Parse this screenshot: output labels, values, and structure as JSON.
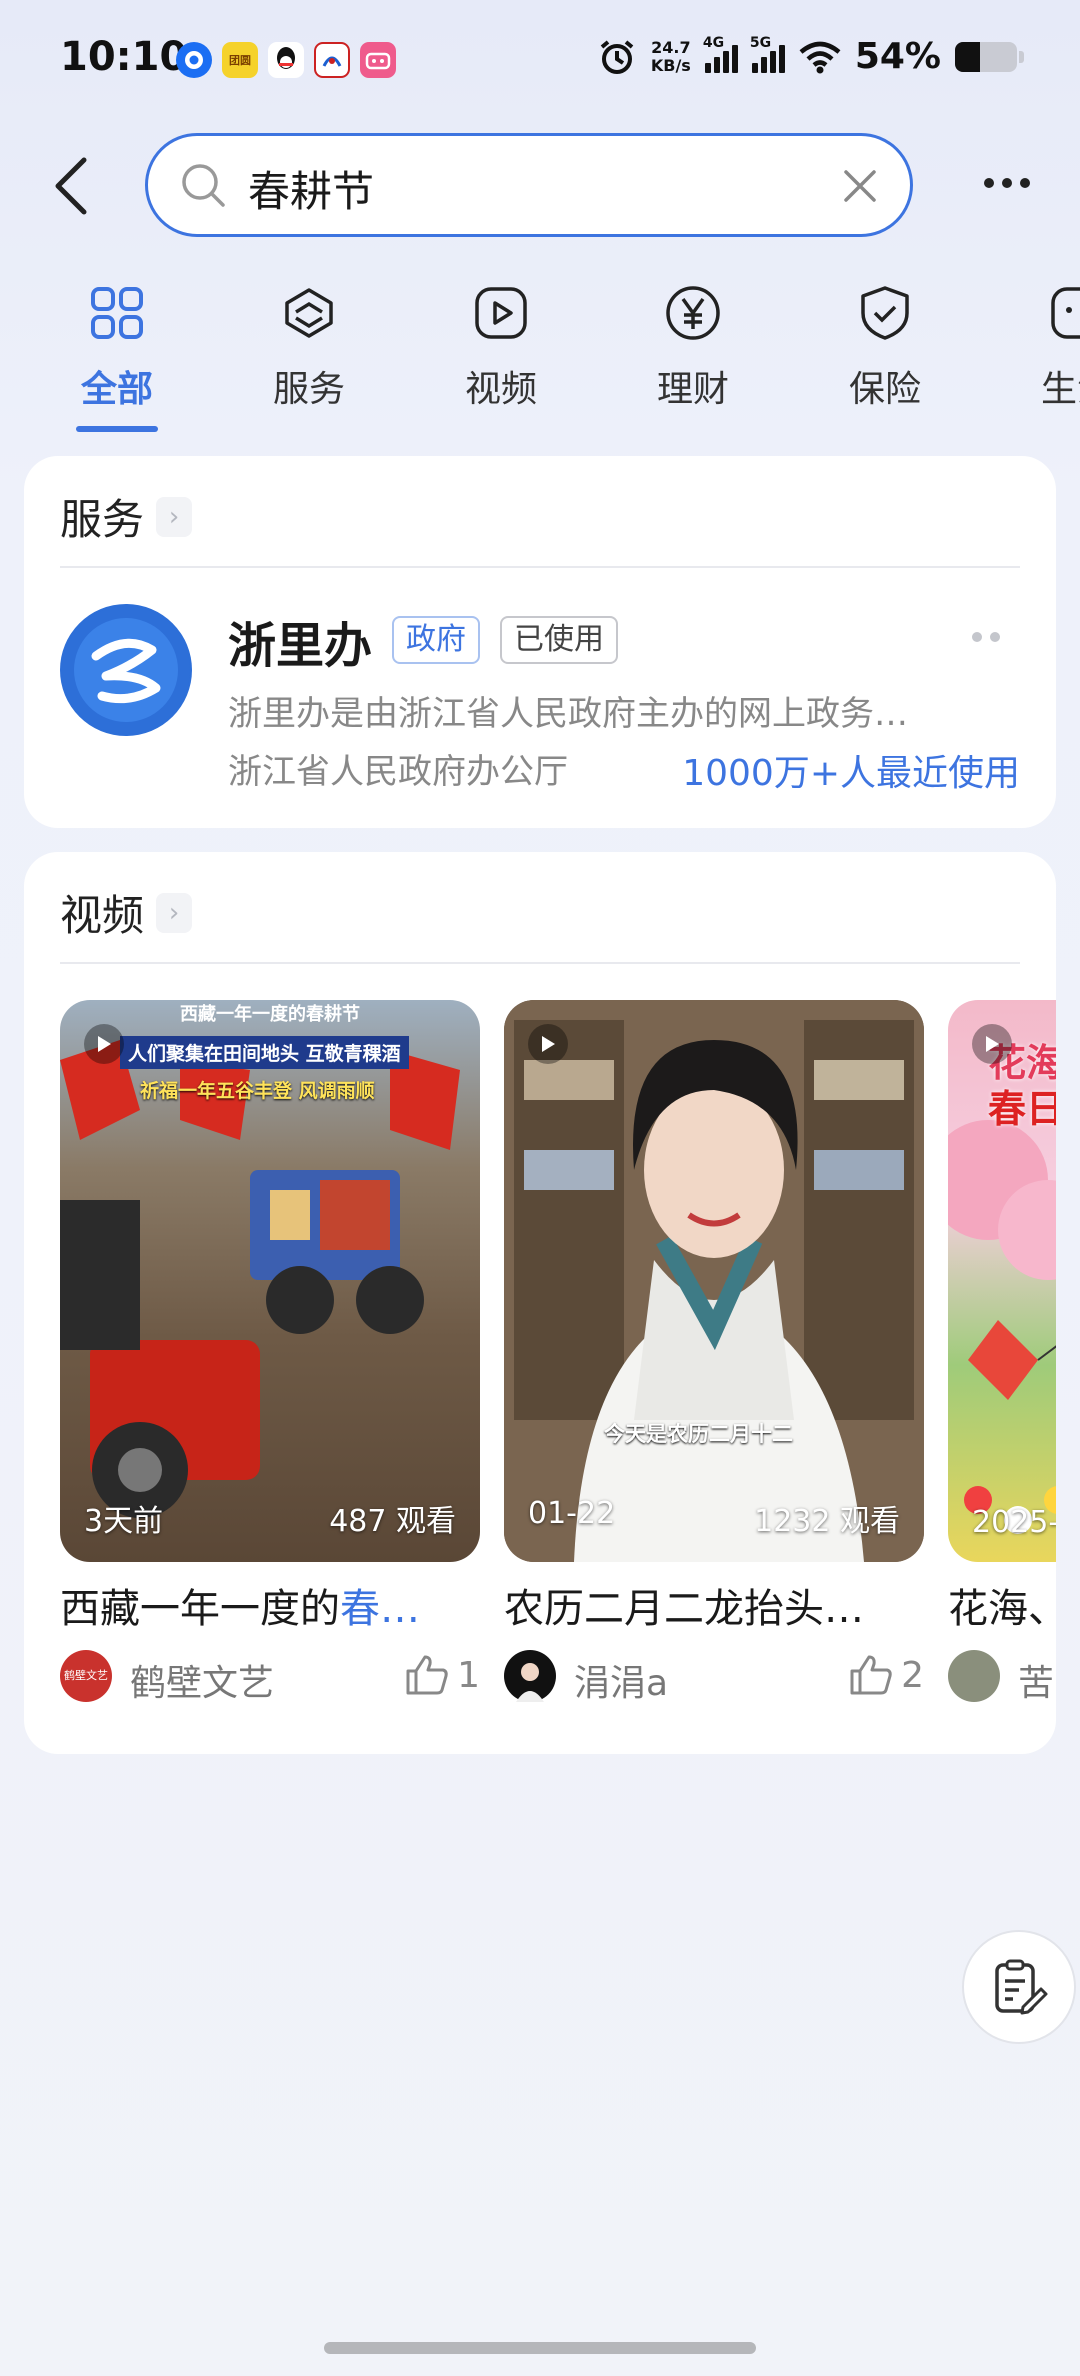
{
  "status_bar": {
    "time": "10:10",
    "net_speed_value": "24.7",
    "net_speed_unit": "KB/s",
    "sig1": "4G",
    "sig2": "5G",
    "battery": "54%",
    "battery_level": 0.54,
    "app_badges": [
      "钉",
      "团圆",
      "QQ",
      "铁",
      "bilibili"
    ]
  },
  "search": {
    "query": "春耕节"
  },
  "tabs": [
    {
      "label": "全部",
      "icon": "grid-icon"
    },
    {
      "label": "服务",
      "icon": "cube-icon"
    },
    {
      "label": "视频",
      "icon": "play-icon"
    },
    {
      "label": "理财",
      "icon": "yen-icon"
    },
    {
      "label": "保险",
      "icon": "shield-icon"
    },
    {
      "label": "生活",
      "icon": "chat-icon"
    }
  ],
  "service_section": {
    "title": "服务",
    "item": {
      "name": "浙里办",
      "tag_gov": "政府",
      "tag_used": "已使用",
      "description": "浙里办是由浙江省人民政府主办的网上政务…",
      "org": "浙江省人民政府办公厅",
      "usage": "1000万+人最近使用"
    }
  },
  "video_section": {
    "title": "视频",
    "videos": [
      {
        "title_prefix": "西藏一年一度的",
        "title_highlight": "春…",
        "time": "3天前",
        "views": "487 观看",
        "author": "鹤壁文艺",
        "likes": "1",
        "overlay_lines": [
          "西藏一年一度的春耕节",
          "人们聚集在田间地头 互敬青稞酒",
          "祈福一年五谷丰登 风调雨顺"
        ],
        "avatar_text": "鹤壁文艺"
      },
      {
        "title_prefix": "农历二月二龙抬头…",
        "title_highlight": "",
        "time": "01-22",
        "views": "1232 观看",
        "author": "涓涓a",
        "likes": "2",
        "overlay_lines": [
          "今天是农历二月十二"
        ]
      },
      {
        "title_prefix": "花海、",
        "title_highlight": "",
        "time": "2025-",
        "views": "",
        "author": "苦",
        "likes": "",
        "overlay_lines": [
          "花海",
          "春日"
        ]
      }
    ]
  }
}
